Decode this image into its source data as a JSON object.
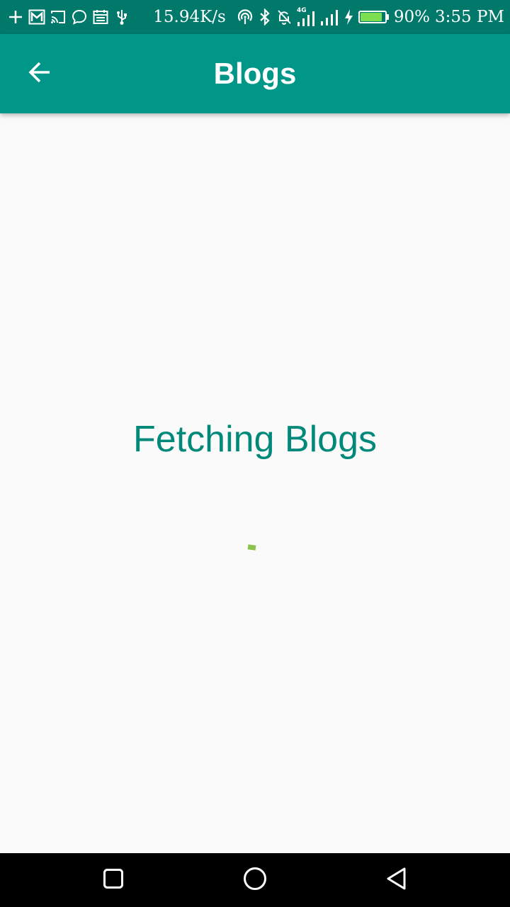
{
  "status_bar": {
    "network_speed": "15.94K/s",
    "network_type": "4G",
    "battery_percent": "90%",
    "battery_level": 0.9,
    "time": "3:55 PM",
    "icons_left": [
      "plus-icon",
      "gmail-icon",
      "cast-icon",
      "message-icon",
      "calendar-icon",
      "usb-icon"
    ],
    "icons_right": [
      "hotspot-icon",
      "bluetooth-icon",
      "notifications-off-icon",
      "signal-4g-icon",
      "signal-icon",
      "charging-icon",
      "battery-icon"
    ]
  },
  "app_bar": {
    "title": "Blogs",
    "back_icon": "arrow-back-icon",
    "color": "#009688"
  },
  "content": {
    "loading_text": "Fetching Blogs",
    "loading_text_color": "#00897b",
    "spinner_color": "#8bc34a"
  },
  "nav_bar": {
    "buttons": [
      "recents-icon",
      "home-icon",
      "back-icon"
    ]
  }
}
